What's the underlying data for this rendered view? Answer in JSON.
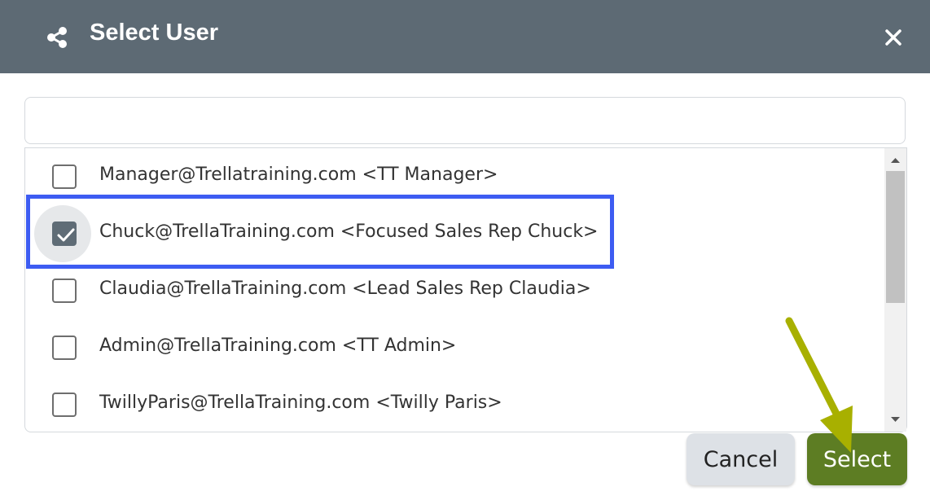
{
  "dialog": {
    "title": "Select User",
    "title_icon": "share-icon",
    "close_icon": "close-icon"
  },
  "search": {
    "value": "",
    "placeholder": ""
  },
  "users": [
    {
      "label": "Manager@Trellatraining.com <TT Manager>",
      "checked": false
    },
    {
      "label": "Chuck@TrellaTraining.com <Focused Sales Rep Chuck>",
      "checked": true
    },
    {
      "label": "Claudia@TrellaTraining.com <Lead Sales Rep Claudia>",
      "checked": false
    },
    {
      "label": "Admin@TrellaTraining.com <TT Admin>",
      "checked": false
    },
    {
      "label": "TwillyParis@TrellaTraining.com <Twilly Paris>",
      "checked": false
    }
  ],
  "buttons": {
    "cancel_label": "Cancel",
    "select_label": "Select"
  },
  "colors": {
    "title_bar": "#5d6a74",
    "highlight_box": "#3d5cf2",
    "select_button": "#5d7d23",
    "annotation_arrow": "#a8b000"
  }
}
